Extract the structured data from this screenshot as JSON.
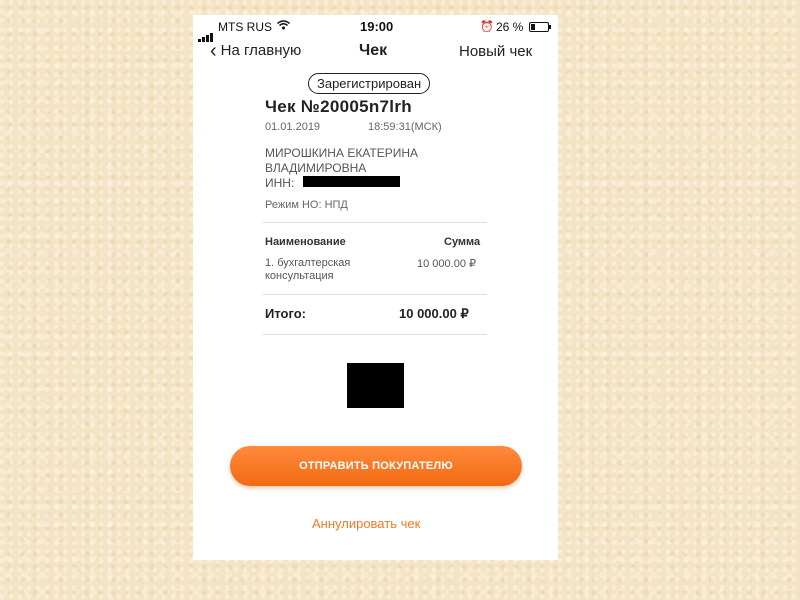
{
  "status_bar": {
    "carrier": "MTS RUS",
    "time": "19:00",
    "battery": "26 %",
    "battery_level": 0.26,
    "icons": [
      "signal-icon",
      "wifi-icon",
      "alarm-icon",
      "battery-icon"
    ]
  },
  "nav": {
    "back_label": "На главную",
    "title": "Чек",
    "new_label": "Новый чек"
  },
  "receipt": {
    "status": "Зарегистрирован",
    "title": "Чек №20005n7lrh",
    "date": "01.01.2019",
    "time": "18:59:31(МСК)",
    "name": "МИРОШКИНА ЕКАТЕРИНА ВЛАДИМИРОВНА",
    "inn_label": "ИНН:",
    "mode": "Режим НО: НПД",
    "col_name": "Наименование",
    "col_sum": "Сумма",
    "items": [
      {
        "name": "1. бухгалтерская консультация",
        "sum": "10 000.00 ₽"
      }
    ],
    "total_label": "Итого:",
    "total_value": "10 000.00 ₽"
  },
  "actions": {
    "send_label": "ОТПРАВИТЬ ПОКУПАТЕЛЮ",
    "cancel_label": "Аннулировать чек"
  },
  "colors": {
    "accent": "#f26a12",
    "link": "#f07a28",
    "background": "#f5e4c4"
  }
}
